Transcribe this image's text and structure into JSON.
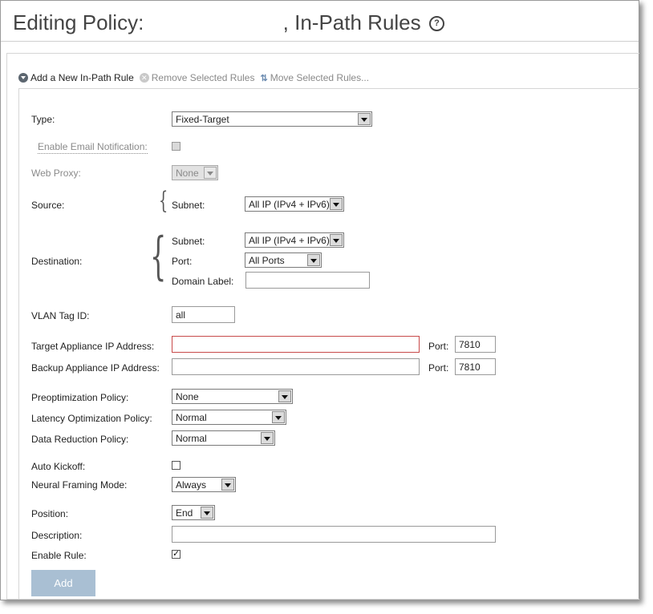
{
  "page": {
    "title": "Editing Policy:                        , In-Path Rules",
    "help_icon": "?"
  },
  "actions": {
    "add": "Add a New In-Path Rule",
    "remove": "Remove Selected Rules",
    "move": "Move Selected Rules..."
  },
  "icons": {
    "add": "chevron-down-circle-icon",
    "remove": "remove-circle-icon",
    "move": "move-arrows-icon"
  },
  "form": {
    "type_label": "Type:",
    "type_value": "Fixed-Target",
    "email_label": "Enable Email Notification:",
    "web_proxy_label": "Web Proxy:",
    "web_proxy_value": "None",
    "source_label": "Source:",
    "source_subnet_label": "Subnet:",
    "source_subnet_value": "All IP (IPv4 + IPv6)",
    "destination_label": "Destination:",
    "dest_subnet_label": "Subnet:",
    "dest_subnet_value": "All IP (IPv4 + IPv6)",
    "dest_port_label": "Port:",
    "dest_port_value": "All Ports",
    "dest_domain_label": "Domain Label:",
    "dest_domain_value": "",
    "vlan_label": "VLAN Tag ID:",
    "vlan_value": "all",
    "target_ip_label": "Target Appliance IP Address:",
    "target_ip_value": "",
    "target_port_label": "Port:",
    "target_port_value": "7810",
    "backup_ip_label": "Backup Appliance IP Address:",
    "backup_ip_value": "",
    "backup_port_label": "Port:",
    "backup_port_value": "7810",
    "preopt_label": "Preoptimization Policy:",
    "preopt_value": "None",
    "latency_label": "Latency Optimization Policy:",
    "latency_value": "Normal",
    "data_reduction_label": "Data Reduction Policy:",
    "data_reduction_value": "Normal",
    "auto_kickoff_label": "Auto Kickoff:",
    "neural_label": "Neural Framing Mode:",
    "neural_value": "Always",
    "position_label": "Position:",
    "position_value": "End",
    "description_label": "Description:",
    "description_value": "",
    "enable_rule_label": "Enable Rule:",
    "enable_rule_mark": "✓",
    "add_button": "Add"
  },
  "colors": {
    "add_button_bg": "#a9bfd3",
    "error_border": "#c84a4a",
    "disabled_text": "#8a8a8a"
  }
}
